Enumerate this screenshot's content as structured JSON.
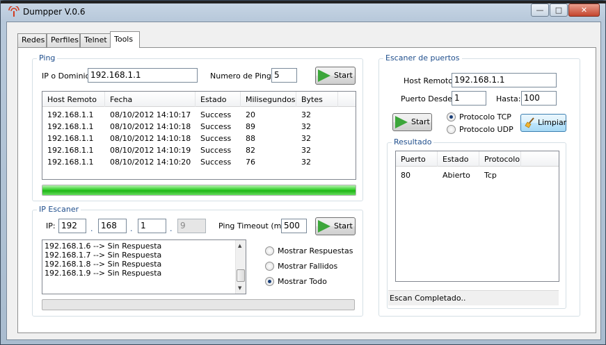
{
  "window": {
    "title": "Dumpper V.0.6",
    "minimize": "—",
    "maximize": "□",
    "close": "✕"
  },
  "tabs": [
    {
      "label": "Redes"
    },
    {
      "label": "Perfiles"
    },
    {
      "label": "Telnet"
    },
    {
      "label": "Tools"
    }
  ],
  "ping": {
    "group_title": "Ping",
    "ip_label": "IP o Dominio:",
    "ip_value": "192.168.1.1",
    "count_label": "Numero de Pings:",
    "count_value": "5",
    "start_label": "Start",
    "columns": [
      "Host Remoto",
      "Fecha",
      "Estado",
      "Milisegundos",
      "Bytes"
    ],
    "rows": [
      [
        "192.168.1.1",
        "08/10/2012 14:10:17",
        "Success",
        "20",
        "32"
      ],
      [
        "192.168.1.1",
        "08/10/2012 14:10:18",
        "Success",
        "89",
        "32"
      ],
      [
        "192.168.1.1",
        "08/10/2012 14:10:18",
        "Success",
        "88",
        "32"
      ],
      [
        "192.168.1.1",
        "08/10/2012 14:10:19",
        "Success",
        "82",
        "32"
      ],
      [
        "192.168.1.1",
        "08/10/2012 14:10:20",
        "Success",
        "76",
        "32"
      ]
    ],
    "progress": 1.0
  },
  "scanner": {
    "group_title": "IP Escaner",
    "ip_label": "IP:",
    "octets": [
      "192",
      "168",
      "1",
      "9"
    ],
    "dot": ".",
    "timeout_label": "Ping Timeout (ms):",
    "timeout_value": "500",
    "start_label": "Start",
    "log": [
      "192.168.1.6 --> Sin Respuesta",
      "192.168.1.7 --> Sin Respuesta",
      "192.168.1.8 --> Sin Respuesta",
      "192.168.1.9 --> Sin Respuesta"
    ],
    "options": [
      {
        "label": "Mostrar Respuestas",
        "checked": false
      },
      {
        "label": "Mostrar Fallidos",
        "checked": false
      },
      {
        "label": "Mostrar Todo",
        "checked": true
      }
    ],
    "progress": 0.0
  },
  "ports": {
    "group_title": "Escaner de puertos",
    "host_label": "Host Remoto:",
    "host_value": "192.168.1.1",
    "from_label": "Puerto Desde:",
    "from_value": "1",
    "to_label": "Hasta:",
    "to_value": "100",
    "proto_tcp": "Protocolo TCP",
    "proto_udp": "Protocolo UDP",
    "start_label": "Start",
    "clear_label": "Limpiar",
    "result_title": "Resultado",
    "columns": [
      "Puerto",
      "Estado",
      "Protocolo"
    ],
    "rows": [
      [
        "80",
        "Abierto",
        "Tcp"
      ]
    ],
    "status": "Escan Completado.."
  }
}
